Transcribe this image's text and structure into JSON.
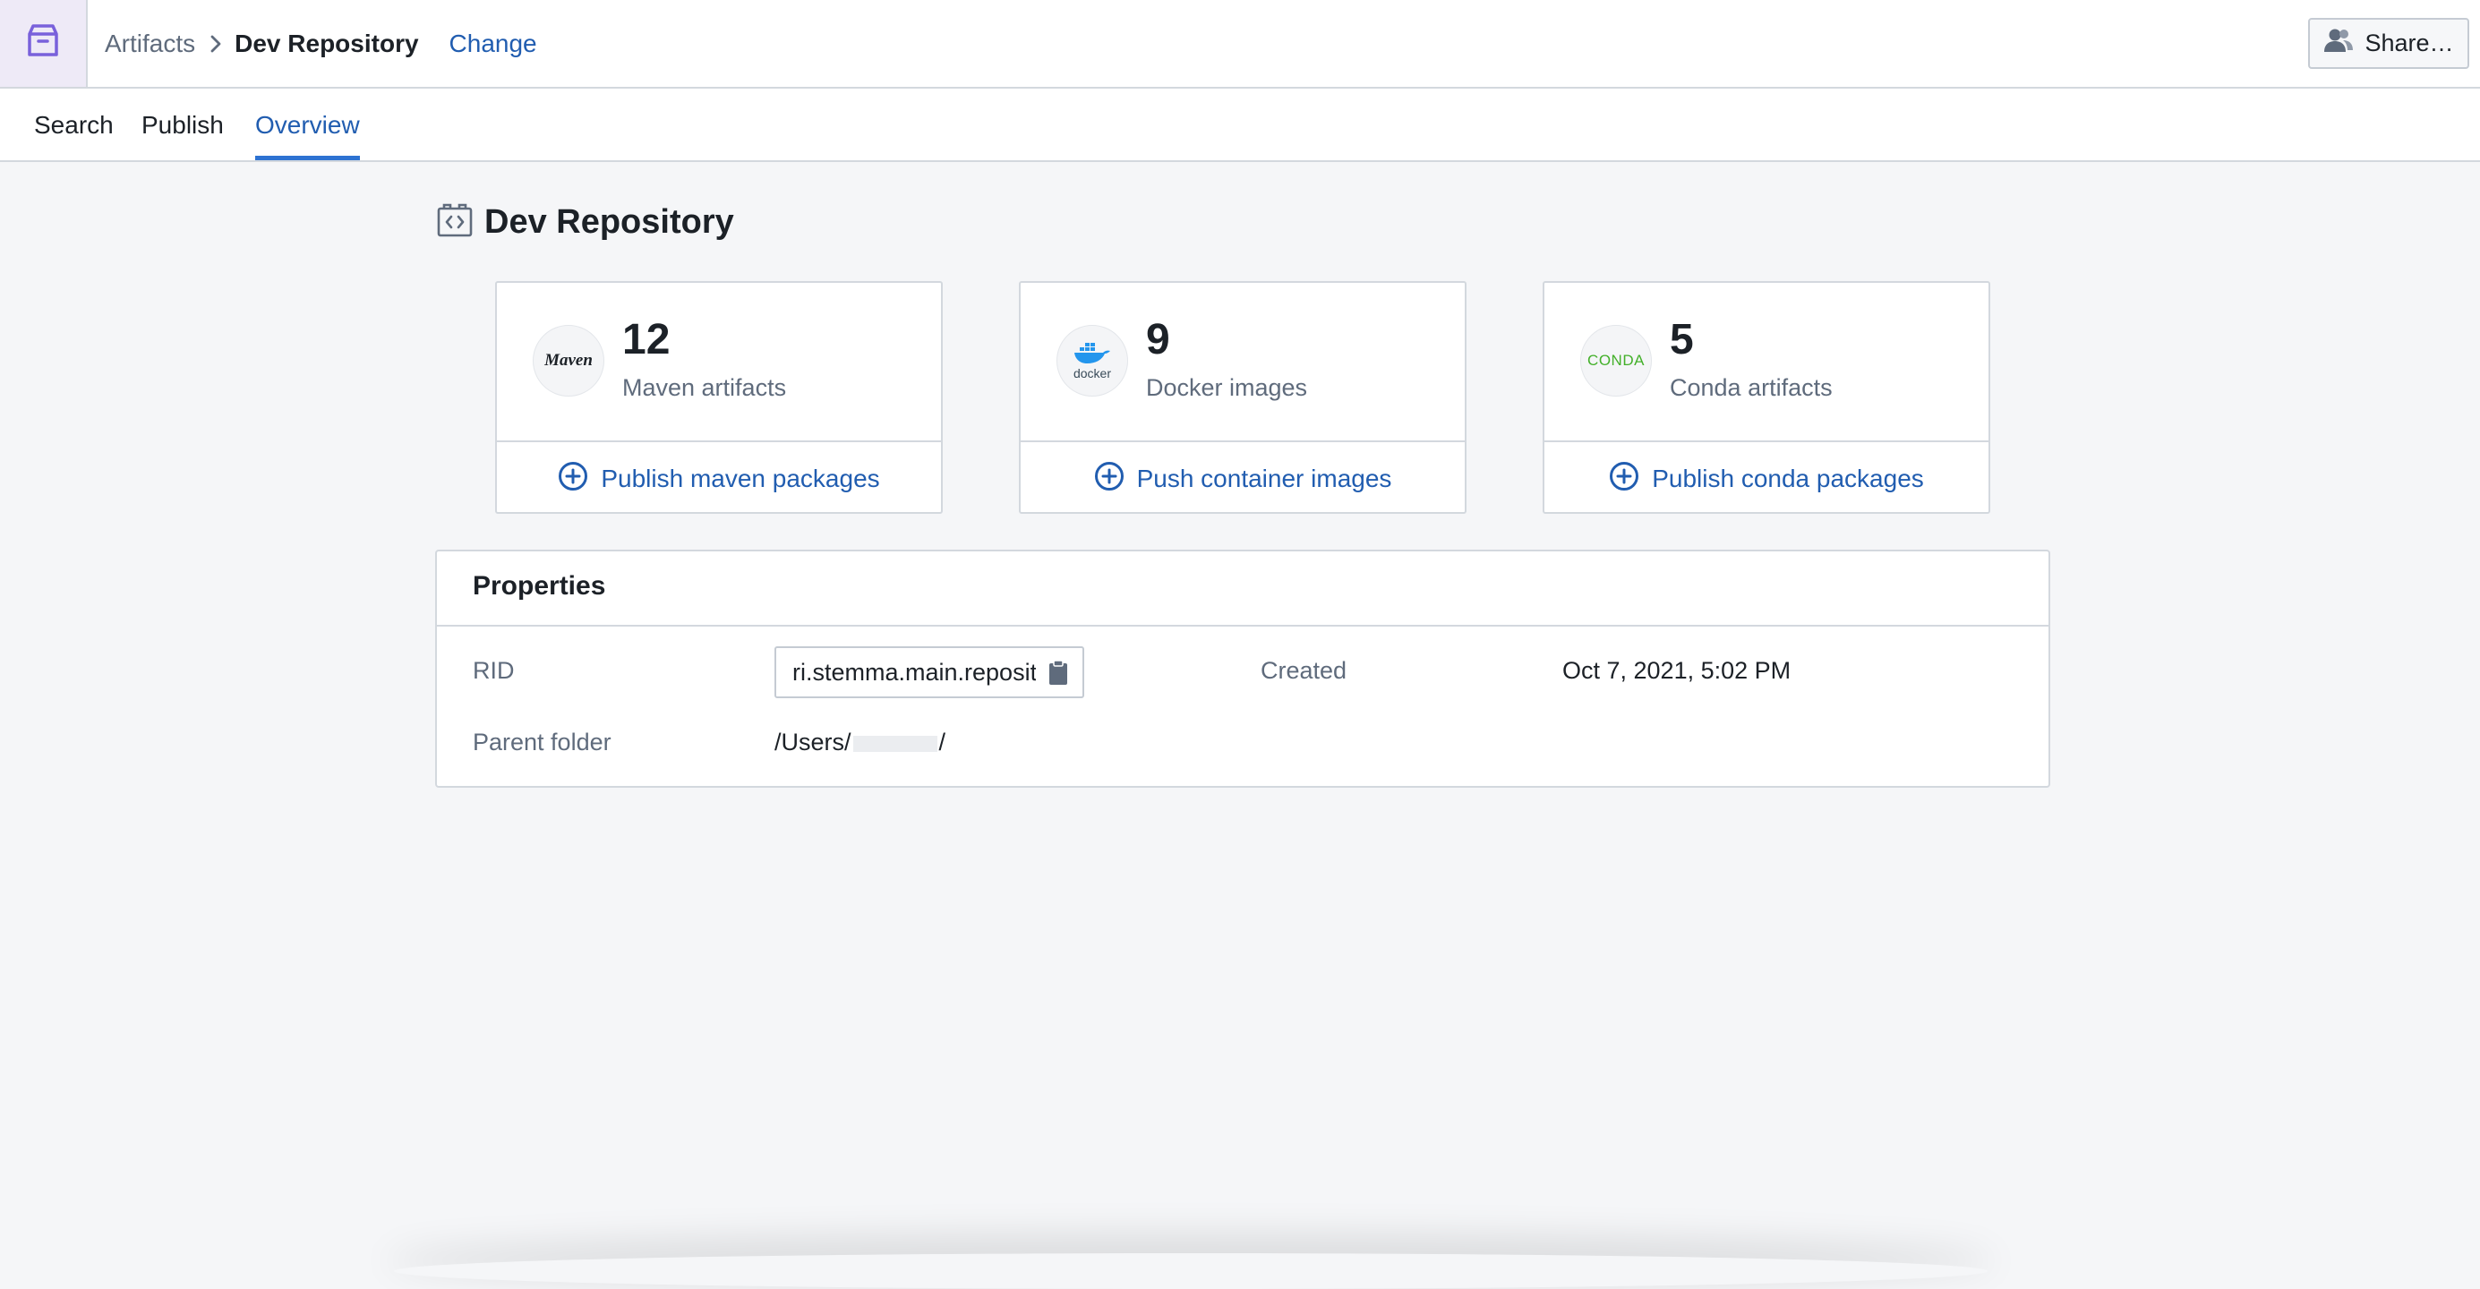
{
  "header": {
    "breadcrumb_root": "Artifacts",
    "breadcrumb_current": "Dev Repository",
    "change_label": "Change",
    "share_label": "Share…"
  },
  "tabs": [
    {
      "label": "Search",
      "active": false
    },
    {
      "label": "Publish",
      "active": false
    },
    {
      "label": "Overview",
      "active": true
    }
  ],
  "page": {
    "title": "Dev Repository",
    "title_icon": "code-repository-icon"
  },
  "cards": [
    {
      "logo": "maven-logo",
      "logo_text": "Maven",
      "count": "12",
      "label": "Maven artifacts",
      "action": "Publish maven packages"
    },
    {
      "logo": "docker-logo",
      "logo_text": "docker",
      "count": "9",
      "label": "Docker images",
      "action": "Push container images"
    },
    {
      "logo": "conda-logo",
      "logo_text": "CONDA",
      "count": "5",
      "label": "Conda artifacts",
      "action": "Publish conda packages"
    }
  ],
  "properties": {
    "title": "Properties",
    "rid_label": "RID",
    "rid_value": "ri.stemma.main.repository",
    "created_label": "Created",
    "created_value": "Oct 7, 2021, 5:02 PM",
    "parent_folder_label": "Parent folder",
    "parent_folder_prefix": "/Users/",
    "parent_folder_suffix": "/"
  },
  "colors": {
    "accent": "#215db0",
    "tab_underline": "#2d72d2",
    "app_icon": "#7961db",
    "docker_blue": "#2496ed",
    "conda_green": "#43b02a"
  }
}
